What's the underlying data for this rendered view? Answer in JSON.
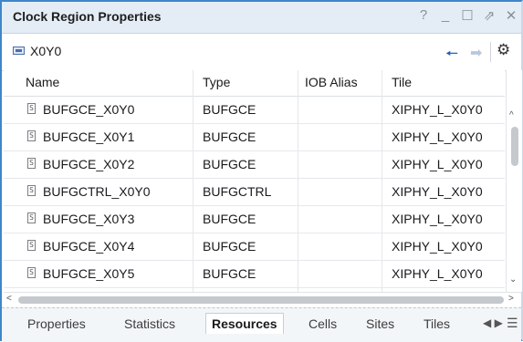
{
  "window": {
    "title": "Clock Region Properties",
    "controls": {
      "help": "?",
      "minimize": "_",
      "maximize": "☐",
      "float": "⇗",
      "close": "✕"
    }
  },
  "toolbar": {
    "object_name": "X0Y0",
    "back_glyph": "🠔",
    "forward_glyph": "➡",
    "settings_glyph": "⚙"
  },
  "table": {
    "columns": [
      "Name",
      "Type",
      "IOB Alias",
      "Tile"
    ],
    "rows": [
      {
        "name": "BUFGCE_X0Y0",
        "type": "BUFGCE",
        "iob_alias": "",
        "tile": "XIPHY_L_X0Y0"
      },
      {
        "name": "BUFGCE_X0Y1",
        "type": "BUFGCE",
        "iob_alias": "",
        "tile": "XIPHY_L_X0Y0"
      },
      {
        "name": "BUFGCE_X0Y2",
        "type": "BUFGCE",
        "iob_alias": "",
        "tile": "XIPHY_L_X0Y0"
      },
      {
        "name": "BUFGCTRL_X0Y0",
        "type": "BUFGCTRL",
        "iob_alias": "",
        "tile": "XIPHY_L_X0Y0"
      },
      {
        "name": "BUFGCE_X0Y3",
        "type": "BUFGCE",
        "iob_alias": "",
        "tile": "XIPHY_L_X0Y0"
      },
      {
        "name": "BUFGCE_X0Y4",
        "type": "BUFGCE",
        "iob_alias": "",
        "tile": "XIPHY_L_X0Y0"
      },
      {
        "name": "BUFGCE_X0Y5",
        "type": "BUFGCE",
        "iob_alias": "",
        "tile": "XIPHY_L_X0Y0"
      }
    ],
    "row_icon_glyph": "S"
  },
  "scrollbars": {
    "up": "^",
    "down": "⌄",
    "left": "<",
    "right": ">"
  },
  "tabs": {
    "items": [
      "Properties",
      "Statistics",
      "Resources",
      "Cells",
      "Sites",
      "Tiles"
    ],
    "active": "Resources",
    "arrows": "◀ ▶",
    "menu": "☰"
  }
}
